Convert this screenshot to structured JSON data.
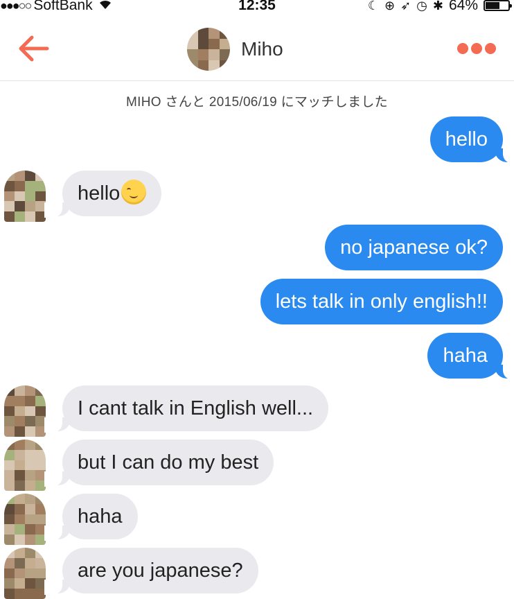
{
  "status_bar": {
    "signal": "●●●○○",
    "carrier": "SoftBank",
    "time": "12:35",
    "icons": [
      "moon-icon",
      "rotation-lock-icon",
      "location-icon",
      "alarm-icon",
      "bluetooth-icon"
    ],
    "battery_percent": "64%",
    "battery_level": 0.64
  },
  "nav": {
    "title": "Miho",
    "back_icon": "back-arrow-icon",
    "more_icon": "more-dots-icon",
    "accent_color": "#f26b52"
  },
  "match_notice": "MIHO さんと 2015/06/19 にマッチしました",
  "messages": [
    {
      "side": "out",
      "text": "hello"
    },
    {
      "side": "in",
      "text": "hello",
      "emoji": "smiling-face-icon"
    },
    {
      "side": "out",
      "text": "no japanese ok?"
    },
    {
      "side": "out",
      "text": "lets talk in only english!!"
    },
    {
      "side": "out",
      "text": "haha"
    },
    {
      "side": "in",
      "text": "I cant talk in English well..."
    },
    {
      "side": "in",
      "text": "but I can do my best"
    },
    {
      "side": "in",
      "text": "haha"
    },
    {
      "side": "in",
      "text": "are you japanese?"
    }
  ],
  "colors": {
    "outgoing_bubble": "#2b8af0",
    "incoming_bubble": "#e9e9ee"
  }
}
